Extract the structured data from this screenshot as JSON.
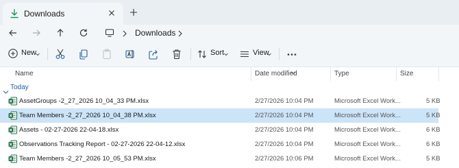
{
  "window": {
    "tab_title": "Downloads"
  },
  "address": {
    "crumbs": [
      "Downloads"
    ]
  },
  "commands": {
    "new_label": "New",
    "sort_label": "Sort",
    "view_label": "View"
  },
  "columns": {
    "name": "Name",
    "date": "Date modified",
    "type": "Type",
    "size": "Size"
  },
  "group": {
    "label": "Today"
  },
  "files": [
    {
      "name": "AssetGroups -2_27_2026 10_04_33 PM.xlsx",
      "date": "2/27/2026 10:04 PM",
      "type": "Microsoft Excel Work...",
      "size": "5 KB",
      "selected": false
    },
    {
      "name": "Team Members -2_27_2026 10_04_38 PM.xlsx",
      "date": "2/27/2026 10:04 PM",
      "type": "Microsoft Excel Work...",
      "size": "5 KB",
      "selected": true
    },
    {
      "name": "Assets - 02-27-2026 22-04-18.xlsx",
      "date": "2/27/2026 10:04 PM",
      "type": "Microsoft Excel Work...",
      "size": "6 KB",
      "selected": false
    },
    {
      "name": "Observations Tracking Report - 02-27-2026 22-04-12.xlsx",
      "date": "2/27/2026 10:04 PM",
      "type": "Microsoft Excel Work...",
      "size": "6 KB",
      "selected": false
    },
    {
      "name": "Team Members -2_27_2026 10_05_53 PM.xlsx",
      "date": "2/27/2026 10:06 PM",
      "type": "Microsoft Excel Work...",
      "size": "5 KB",
      "selected": false
    }
  ],
  "colors": {
    "accent": "#0067c0",
    "selection": "#cce4f7",
    "excel_green": "#1d6f42",
    "chrome_bg": "#f3f6f9"
  }
}
